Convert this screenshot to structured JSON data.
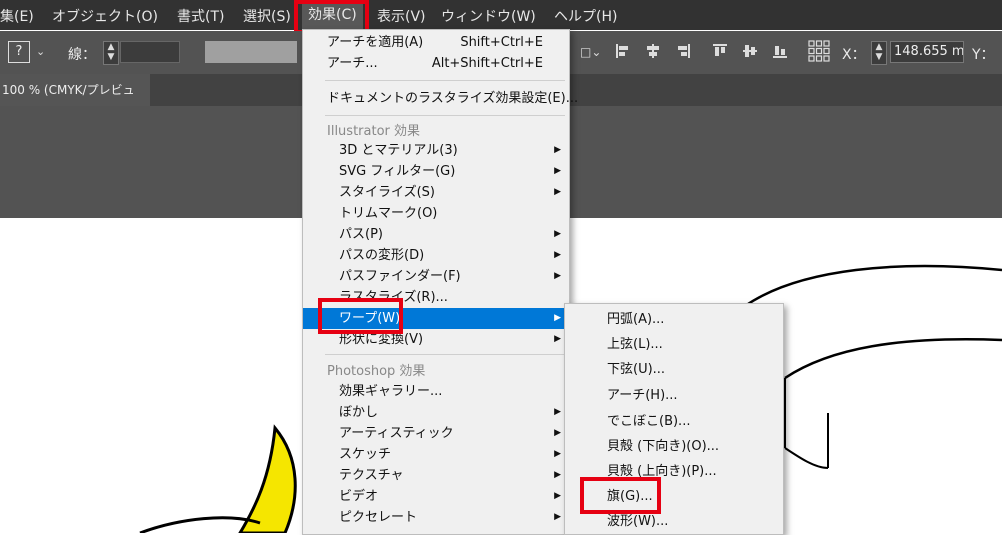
{
  "menubar": {
    "items": [
      {
        "label": "集(E)"
      },
      {
        "label": "オブジェクト(O)"
      },
      {
        "label": "書式(T)"
      },
      {
        "label": "選択(S)"
      },
      {
        "label": "効果(C)"
      },
      {
        "label": "表示(V)"
      },
      {
        "label": "ウィンドウ(W)"
      },
      {
        "label": "ヘルプ(H)"
      }
    ]
  },
  "controlbar": {
    "question": "?",
    "stroke_label": "線：",
    "x_label": "X：",
    "x_value": "148.655 m",
    "y_label": "Y："
  },
  "document": {
    "tab_label": "100 % (CMYK/プレビュー)"
  },
  "effect_menu": {
    "apply_last": {
      "label": "アーチを適用(A)",
      "shortcut": "Shift+Ctrl+E"
    },
    "last": {
      "label": "アーチ...",
      "shortcut": "Alt+Shift+Ctrl+E"
    },
    "raster_settings": "ドキュメントのラスタライズ効果設定(E)...",
    "illustrator_header": "Illustrator 効果",
    "illustrator_items": [
      {
        "label": "3D とマテリアル(3)",
        "submenu": true
      },
      {
        "label": "SVG フィルター(G)",
        "submenu": true
      },
      {
        "label": "スタイライズ(S)",
        "submenu": true
      },
      {
        "label": "トリムマーク(O)",
        "submenu": false
      },
      {
        "label": "パス(P)",
        "submenu": true
      },
      {
        "label": "パスの変形(D)",
        "submenu": true
      },
      {
        "label": "パスファインダー(F)",
        "submenu": true
      },
      {
        "label": "ラスタライズ(R)...",
        "submenu": false
      },
      {
        "label": "ワープ(W)",
        "submenu": true
      },
      {
        "label": "形状に変換(V)",
        "submenu": true
      }
    ],
    "photoshop_header": "Photoshop 効果",
    "photoshop_items": [
      {
        "label": "効果ギャラリー...",
        "submenu": false
      },
      {
        "label": "ぼかし",
        "submenu": true
      },
      {
        "label": "アーティスティック",
        "submenu": true
      },
      {
        "label": "スケッチ",
        "submenu": true
      },
      {
        "label": "テクスチャ",
        "submenu": true
      },
      {
        "label": "ビデオ",
        "submenu": true
      },
      {
        "label": "ピクセレート",
        "submenu": true
      }
    ]
  },
  "warp_submenu": {
    "items": [
      {
        "label": "円弧(A)..."
      },
      {
        "label": "上弦(L)..."
      },
      {
        "label": "下弦(U)..."
      },
      {
        "label": "アーチ(H)..."
      },
      {
        "label": "でこぼこ(B)..."
      },
      {
        "label": "貝殻 (下向き)(O)..."
      },
      {
        "label": "貝殻 (上向き)(P)..."
      },
      {
        "label": "旗(G)..."
      },
      {
        "label": "波形(W)..."
      }
    ]
  },
  "colors": {
    "highlight_box": "#e60012",
    "menu_selection": "#0078d7",
    "menubar_bg": "#323232",
    "artwork_yellow": "#f5e600"
  }
}
